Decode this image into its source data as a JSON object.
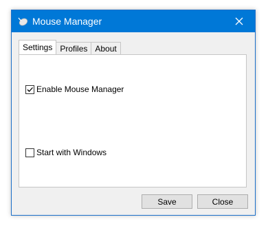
{
  "window": {
    "title": "Mouse Manager"
  },
  "tabs": [
    {
      "label": "Settings"
    },
    {
      "label": "Profiles"
    },
    {
      "label": "About"
    }
  ],
  "settings": {
    "enable": {
      "label": "Enable Mouse Manager",
      "checked": true
    },
    "startup": {
      "label": "Start with Windows",
      "checked": false
    }
  },
  "buttons": {
    "save": "Save",
    "close": "Close"
  },
  "icons": {
    "app": "mouse-icon",
    "close": "close-icon",
    "check": "checkmark-icon"
  },
  "colors": {
    "titlebar": "#0078d7",
    "background": "#f0f0f0"
  }
}
